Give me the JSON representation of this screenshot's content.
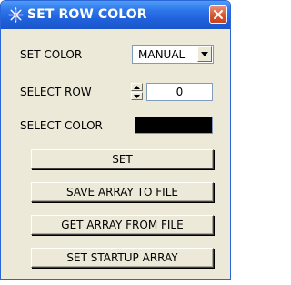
{
  "window": {
    "title": "SET ROW COLOR",
    "icon": "sparkle-icon",
    "close_icon": "close-icon",
    "accent_color": "#2360d8"
  },
  "form": {
    "set_color_label": "SET COLOR",
    "set_color_value": "MANUAL",
    "select_row_label": "SELECT ROW",
    "select_row_value": "0",
    "select_color_label": "SELECT COLOR",
    "selected_color": "#000000"
  },
  "buttons": {
    "set": "SET",
    "save_array": "SAVE ARRAY TO FILE",
    "get_array": "GET ARRAY FROM FILE",
    "set_startup": "SET STARTUP ARRAY"
  }
}
